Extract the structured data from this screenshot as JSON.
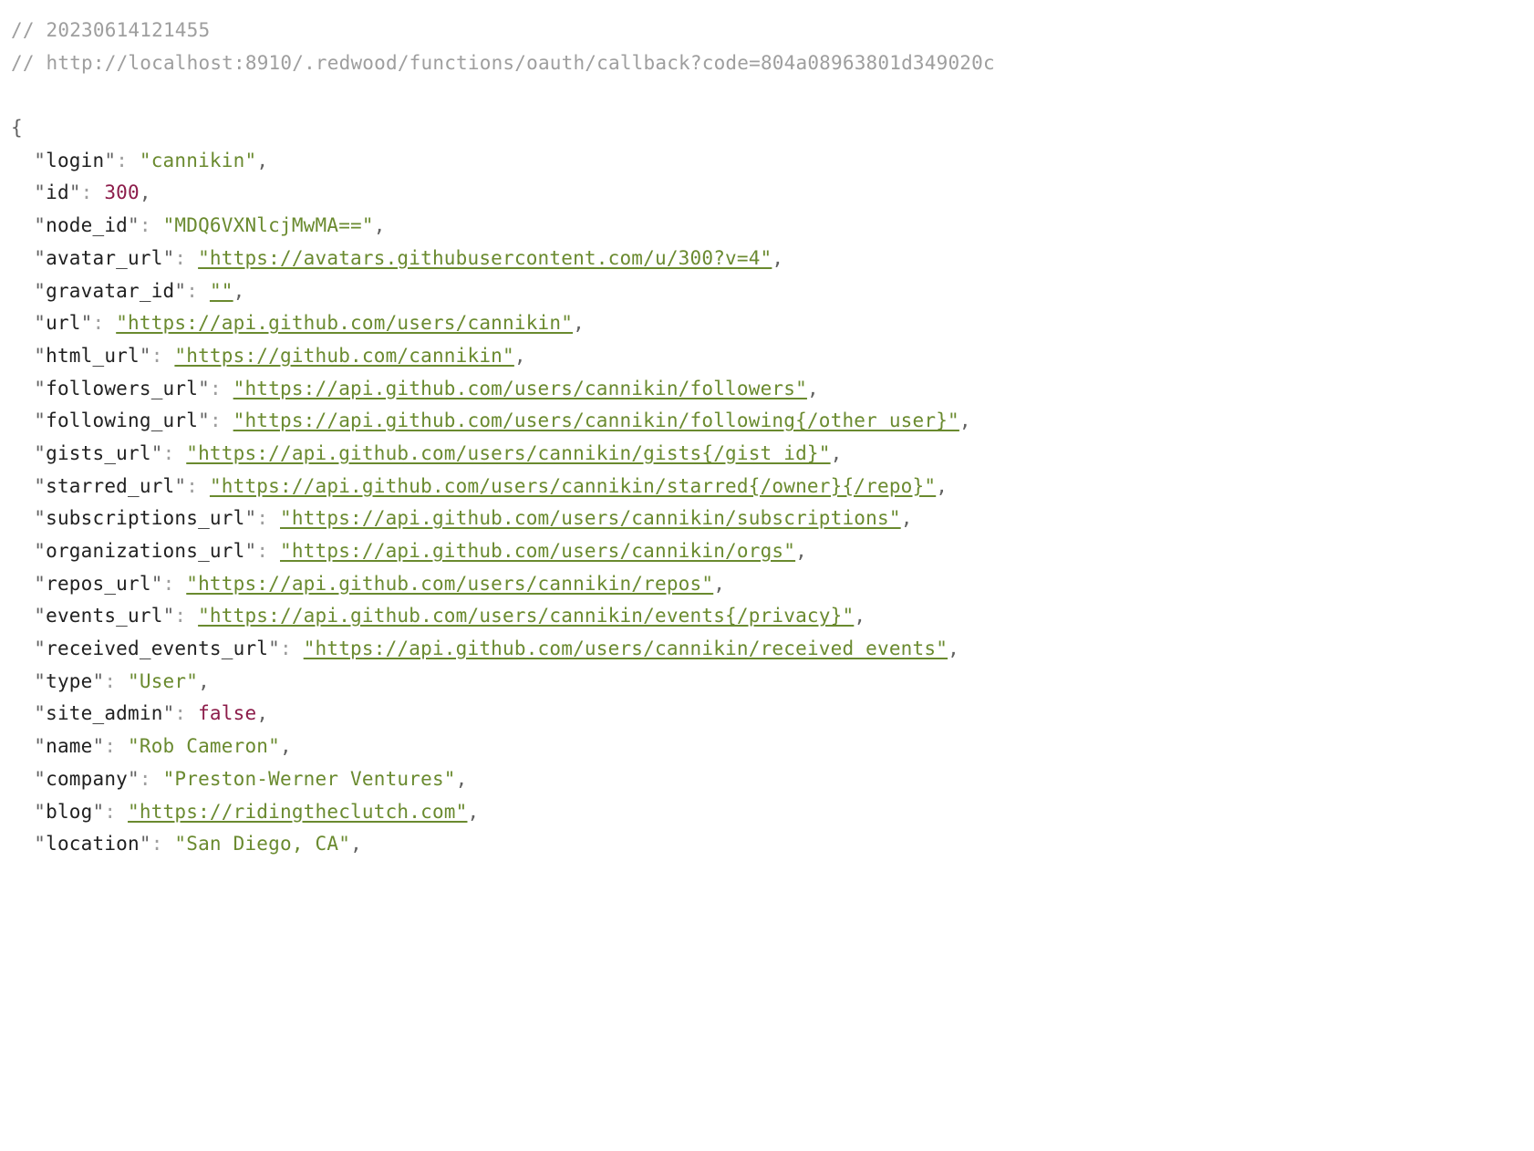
{
  "header": {
    "timestamp_comment": "// 20230614121455",
    "url_comment": "// http://localhost:8910/.redwood/functions/oauth/callback?code=804a08963801d349020c"
  },
  "json": {
    "open_brace": "{",
    "entries": [
      {
        "key": "login",
        "kind": "string",
        "value": "cannikin"
      },
      {
        "key": "id",
        "kind": "number",
        "value": "300"
      },
      {
        "key": "node_id",
        "kind": "string",
        "value": "MDQ6VXNlcjMwMA=="
      },
      {
        "key": "avatar_url",
        "kind": "link",
        "value": "https://avatars.githubusercontent.com/u/300?v=4"
      },
      {
        "key": "gravatar_id",
        "kind": "link",
        "value": ""
      },
      {
        "key": "url",
        "kind": "link",
        "value": "https://api.github.com/users/cannikin"
      },
      {
        "key": "html_url",
        "kind": "link",
        "value": "https://github.com/cannikin"
      },
      {
        "key": "followers_url",
        "kind": "link",
        "value": "https://api.github.com/users/cannikin/followers"
      },
      {
        "key": "following_url",
        "kind": "link",
        "value": "https://api.github.com/users/cannikin/following{/other_user}"
      },
      {
        "key": "gists_url",
        "kind": "link",
        "value": "https://api.github.com/users/cannikin/gists{/gist_id}"
      },
      {
        "key": "starred_url",
        "kind": "link",
        "value": "https://api.github.com/users/cannikin/starred{/owner}{/repo}"
      },
      {
        "key": "subscriptions_url",
        "kind": "link",
        "value": "https://api.github.com/users/cannikin/subscriptions"
      },
      {
        "key": "organizations_url",
        "kind": "link",
        "value": "https://api.github.com/users/cannikin/orgs"
      },
      {
        "key": "repos_url",
        "kind": "link",
        "value": "https://api.github.com/users/cannikin/repos"
      },
      {
        "key": "events_url",
        "kind": "link",
        "value": "https://api.github.com/users/cannikin/events{/privacy}"
      },
      {
        "key": "received_events_url",
        "kind": "link",
        "value": "https://api.github.com/users/cannikin/received_events"
      },
      {
        "key": "type",
        "kind": "string",
        "value": "User"
      },
      {
        "key": "site_admin",
        "kind": "bool",
        "value": "false"
      },
      {
        "key": "name",
        "kind": "string",
        "value": "Rob Cameron"
      },
      {
        "key": "company",
        "kind": "string",
        "value": "Preston-Werner Ventures"
      },
      {
        "key": "blog",
        "kind": "link",
        "value": "https://ridingtheclutch.com"
      },
      {
        "key": "location",
        "kind": "string",
        "value": "San Diego, CA"
      }
    ]
  }
}
